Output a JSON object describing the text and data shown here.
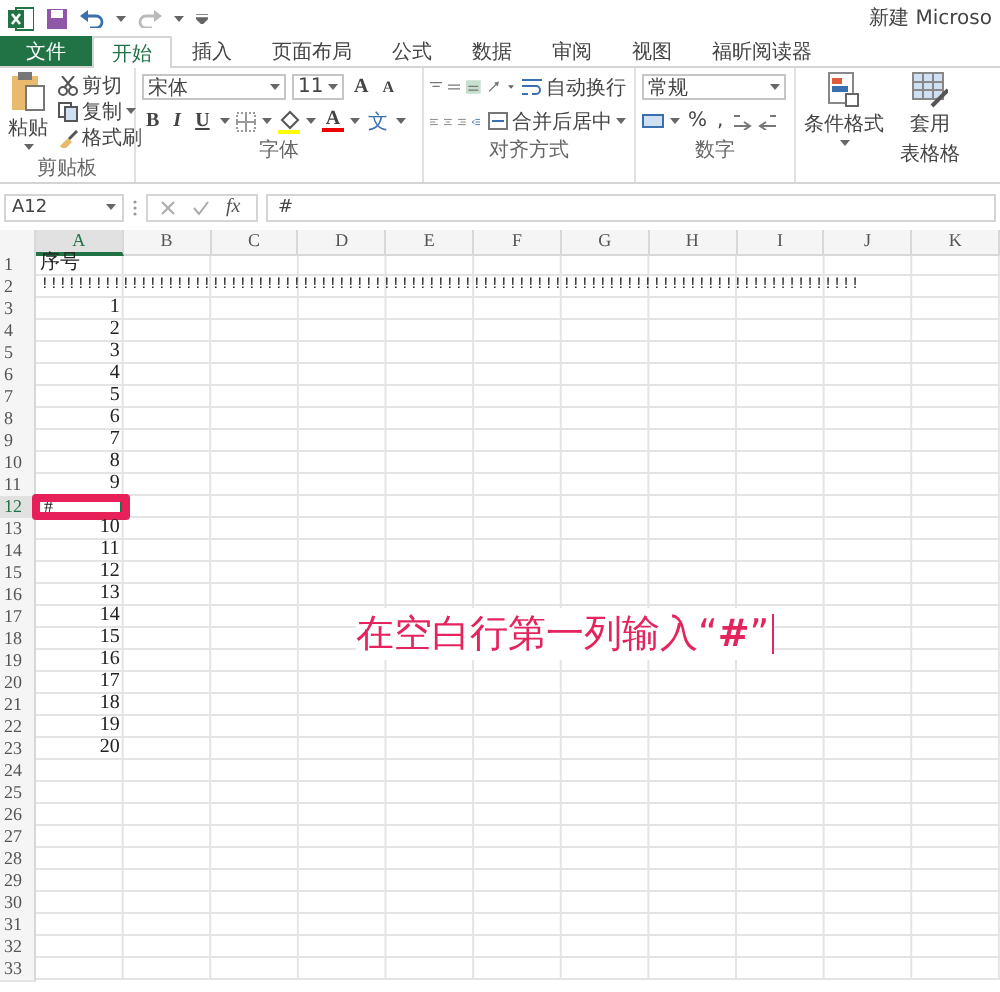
{
  "title_bar": {
    "title": "新建 Microso"
  },
  "tabs": [
    {
      "label": "文件",
      "kind": "file",
      "selected": false
    },
    {
      "label": "开始",
      "kind": "tab",
      "selected": true
    },
    {
      "label": "插入",
      "kind": "tab",
      "selected": false
    },
    {
      "label": "页面布局",
      "kind": "tab",
      "selected": false
    },
    {
      "label": "公式",
      "kind": "tab",
      "selected": false
    },
    {
      "label": "数据",
      "kind": "tab",
      "selected": false
    },
    {
      "label": "审阅",
      "kind": "tab",
      "selected": false
    },
    {
      "label": "视图",
      "kind": "tab",
      "selected": false
    },
    {
      "label": "福昕阅读器",
      "kind": "tab",
      "selected": false
    }
  ],
  "ribbon": {
    "clipboard": {
      "label": "剪贴板",
      "paste": "粘贴",
      "cut": "剪切",
      "copy": "复制",
      "format_painter": "格式刷"
    },
    "font": {
      "label": "字体",
      "name": "宋体",
      "size": "11",
      "grow": "A",
      "shrink": "A",
      "bold": "B",
      "italic": "I",
      "underline": "U",
      "font_color": "A",
      "phonetic": "文"
    },
    "alignment": {
      "label": "对齐方式",
      "wrap_text": "自动换行",
      "merge_center": "合并后居中"
    },
    "number": {
      "label": "数字",
      "format": "常规",
      "percent": "%",
      "comma": ","
    },
    "styles": {
      "conditional_formatting": "条件格式",
      "format_as_table": [
        "套用",
        "表格格"
      ]
    }
  },
  "formula_bar": {
    "name_box": "A12",
    "fx": "fx",
    "content": "#"
  },
  "sheet": {
    "columns": [
      {
        "label": "A",
        "selected": true
      },
      {
        "label": "B",
        "selected": false
      },
      {
        "label": "C",
        "selected": false
      },
      {
        "label": "D",
        "selected": false
      },
      {
        "label": "E",
        "selected": false
      },
      {
        "label": "F",
        "selected": false
      },
      {
        "label": "G",
        "selected": false
      },
      {
        "label": "H",
        "selected": false
      },
      {
        "label": "I",
        "selected": false
      },
      {
        "label": "J",
        "selected": false
      },
      {
        "label": "K",
        "selected": false
      }
    ],
    "rows": [
      {
        "number": "1",
        "kind": "text",
        "value": "序号",
        "selected": false
      },
      {
        "number": "2",
        "kind": "fill",
        "value": "!!!!!!!!!!!!!!!!!!!!!!!!!!!!!!!!!!!!!!!!!!!!!!!!!!!!!!!!!!!!!!!!!!!!!!!!!!!!!!!!!!!!!!!!!!!",
        "selected": false
      },
      {
        "number": "3",
        "kind": "number",
        "value": "1",
        "selected": false
      },
      {
        "number": "4",
        "kind": "number",
        "value": "2",
        "selected": false
      },
      {
        "number": "5",
        "kind": "number",
        "value": "3",
        "selected": false
      },
      {
        "number": "6",
        "kind": "number",
        "value": "4",
        "selected": false
      },
      {
        "number": "7",
        "kind": "number",
        "value": "5",
        "selected": false
      },
      {
        "number": "8",
        "kind": "number",
        "value": "6",
        "selected": false
      },
      {
        "number": "9",
        "kind": "number",
        "value": "7",
        "selected": false
      },
      {
        "number": "10",
        "kind": "number",
        "value": "8",
        "selected": false
      },
      {
        "number": "11",
        "kind": "number",
        "value": "9",
        "selected": false
      },
      {
        "number": "12",
        "kind": "text",
        "value": "#",
        "selected": true
      },
      {
        "number": "13",
        "kind": "number",
        "value": "10",
        "selected": false
      },
      {
        "number": "14",
        "kind": "number",
        "value": "11",
        "selected": false
      },
      {
        "number": "15",
        "kind": "number",
        "value": "12",
        "selected": false
      },
      {
        "number": "16",
        "kind": "number",
        "value": "13",
        "selected": false
      },
      {
        "number": "17",
        "kind": "number",
        "value": "14",
        "selected": false
      },
      {
        "number": "18",
        "kind": "number",
        "value": "15",
        "selected": false
      },
      {
        "number": "19",
        "kind": "number",
        "value": "16",
        "selected": false
      },
      {
        "number": "20",
        "kind": "number",
        "value": "17",
        "selected": false
      },
      {
        "number": "21",
        "kind": "number",
        "value": "18",
        "selected": false
      },
      {
        "number": "22",
        "kind": "number",
        "value": "19",
        "selected": false
      },
      {
        "number": "23",
        "kind": "number",
        "value": "20",
        "selected": false
      },
      {
        "number": "24",
        "kind": "empty",
        "selected": false
      },
      {
        "number": "25",
        "kind": "empty",
        "selected": false
      },
      {
        "number": "26",
        "kind": "empty",
        "selected": false
      },
      {
        "number": "27",
        "kind": "empty",
        "selected": false
      },
      {
        "number": "28",
        "kind": "empty",
        "selected": false
      },
      {
        "number": "29",
        "kind": "empty",
        "selected": false
      },
      {
        "number": "30",
        "kind": "empty",
        "selected": false
      },
      {
        "number": "31",
        "kind": "empty",
        "selected": false
      },
      {
        "number": "32",
        "kind": "empty",
        "selected": false
      },
      {
        "number": "33",
        "kind": "empty",
        "selected": false
      }
    ]
  },
  "annotation": {
    "text": "在空白行第一列输入“**#**”"
  }
}
